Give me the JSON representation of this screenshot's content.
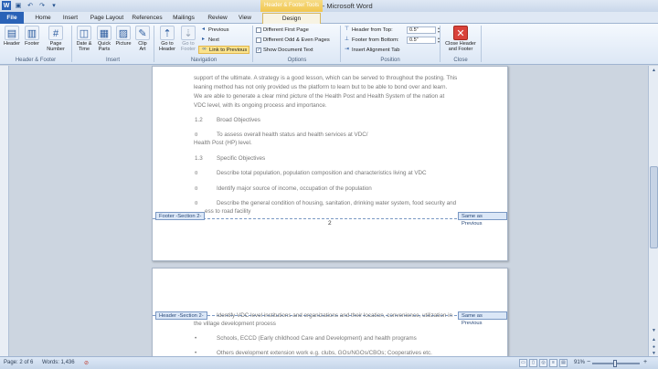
{
  "window": {
    "title": "Document1 - Microsoft Word",
    "contextual_tab": "Header & Footer Tools"
  },
  "tabs": [
    "File",
    "Home",
    "Insert",
    "Page Layout",
    "References",
    "Mailings",
    "Review",
    "View",
    "Design"
  ],
  "ribbon": {
    "header_footer": {
      "header": "Header",
      "footer": "Footer",
      "page_number": "Page Number",
      "label": "Header & Footer"
    },
    "insert": {
      "date_time": "Date & Time",
      "quick_parts": "Quick Parts",
      "picture": "Picture",
      "clip_art": "Clip Art",
      "label": "Insert"
    },
    "navigation": {
      "goto_header": "Go to Header",
      "goto_footer": "Go to Footer",
      "previous": "Previous",
      "next": "Next",
      "link_previous": "Link to Previous",
      "label": "Navigation"
    },
    "options": {
      "diff_first": "Different First Page",
      "diff_odd_even": "Different Odd & Even Pages",
      "show_doc_text": "Show Document Text",
      "diff_first_checked": false,
      "diff_odd_even_checked": false,
      "show_doc_text_checked": true,
      "label": "Options"
    },
    "position": {
      "header_from_top_label": "Header from Top:",
      "header_from_top_value": "0.5\"",
      "footer_from_bottom_label": "Footer from Bottom:",
      "footer_from_bottom_value": "0.5\"",
      "insert_alignment_tab": "Insert Alignment Tab",
      "label": "Position"
    },
    "close": {
      "close_button": "Close Header and Footer",
      "label": "Close"
    }
  },
  "page1": {
    "lines": [
      "support of the ultimate. A strategy is a good lesson, which can be served to throughout the posting. This",
      "leaning method has not only provided us the platform to learn but to be able to bond over and learn.",
      "We are able to generate a clear mind picture of the Health Post and Health System of the nation at",
      "VDC level, with its ongoing process and importance."
    ],
    "heading_1_num": "1.2",
    "heading_1": "Broad Objectives",
    "bullet_1": "To assess overall health status and health services at VDC/",
    "bullet_1_cont": "Health Post (HP) level.",
    "heading_2_num": "1.3",
    "heading_2": "Specific Objectives",
    "bullet_2": "Describe total population, population composition and characteristics living at VDC",
    "bullet_3": "Identify major source of income, occupation of the population",
    "bullet_4": "Describe the general condition of housing, sanitation, drinking water system, food security and",
    "bullet_4_cont": "ess to road facility",
    "bullet_mark": "¤",
    "footer_tag": "Footer -Section 2-",
    "same_as_previous": "Same as Previous",
    "page_number": "2"
  },
  "page2": {
    "header_tag": "Header -Section 2-",
    "same_as_previous": "Same as Previous",
    "line_1": "Identify VDC level institutions and organizations and their location, convenience, utilization in",
    "line_2": "the village development process",
    "bullet_1": "Schools, ECCD (Early childhood Care and Development) and health programs",
    "bullet_2": "Others development extension work e.g. clubs, GOs/NGOs/CBOs; Cooperatives etc.",
    "bullet_mark": "•"
  },
  "status": {
    "page": "Page: 2 of 6",
    "words": "Words: 1,436",
    "zoom": "91%",
    "zoom_level_percent": 91
  }
}
